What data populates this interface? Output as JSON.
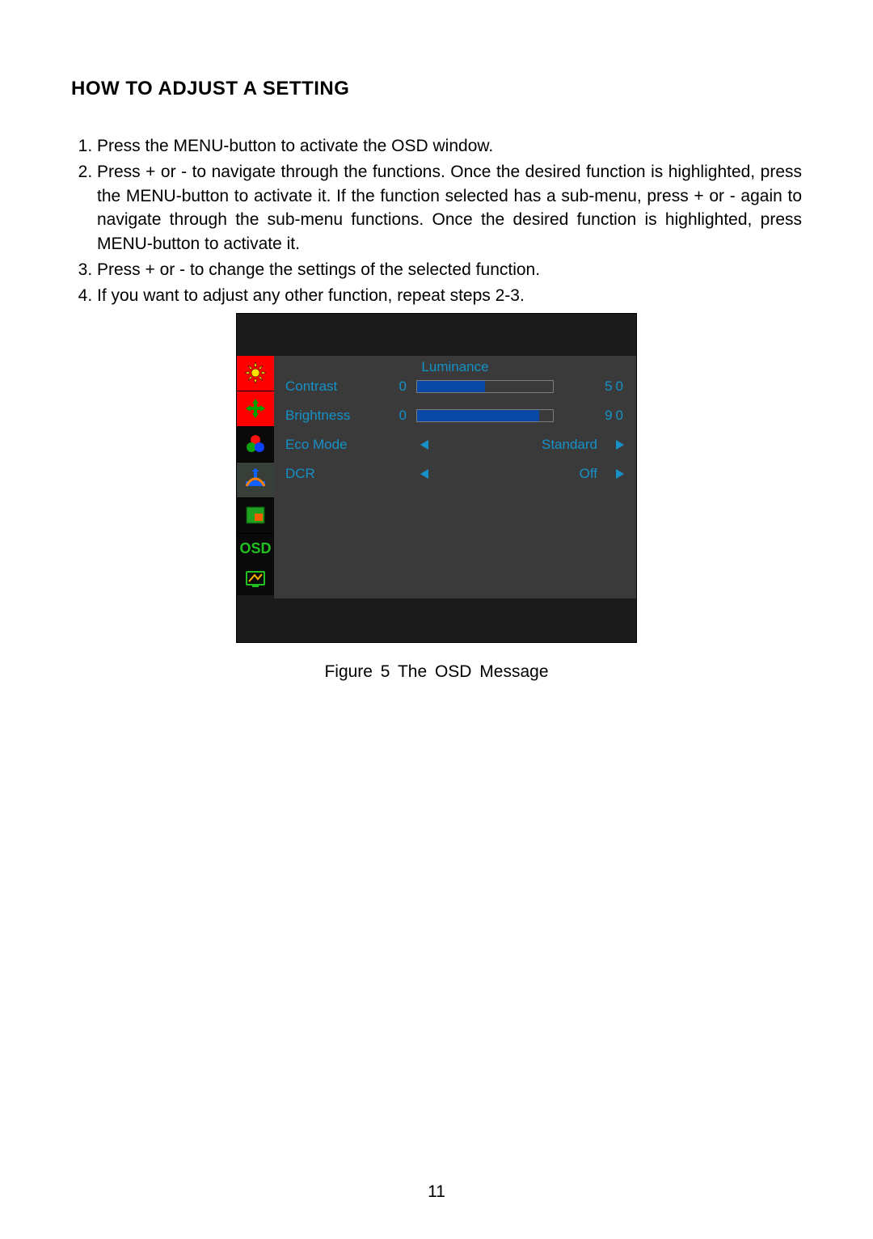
{
  "title": "HOW TO ADJUST A SETTING",
  "steps": [
    "Press the MENU-button to activate the OSD window.",
    "Press + or - to navigate through the functions. Once the desired function is highlighted, press the MENU-button  to activate it.  If the function selected has a sub-menu, press + or - again to navigate through the sub-menu functions.  Once the desired function is highlighted, press MENU-button to activate it.",
    "Press + or - to change the settings of the selected function.",
    "If you want to adjust any other function, repeat steps 2-3."
  ],
  "osd": {
    "menu_title": "Luminance",
    "rows": {
      "contrast": {
        "label": "Contrast",
        "min": "0",
        "value": "50",
        "percent": 50
      },
      "brightness": {
        "label": "Brightness",
        "min": "0",
        "value": "90",
        "percent": 90
      },
      "eco": {
        "label": "Eco Mode",
        "option": "Standard"
      },
      "dcr": {
        "label": "DCR",
        "option": "Off"
      }
    },
    "sidebar_labels": {
      "luminance": "luminance-tab",
      "position": "position-tab",
      "color": "color-tab",
      "auto": "autoadjust-tab",
      "picture": "picture-tab",
      "osd": "osd-setup-tab",
      "info": "information-tab"
    },
    "osd_text": "OSD"
  },
  "caption": "Figure 5    The  OSD  Message",
  "page_number": "11"
}
